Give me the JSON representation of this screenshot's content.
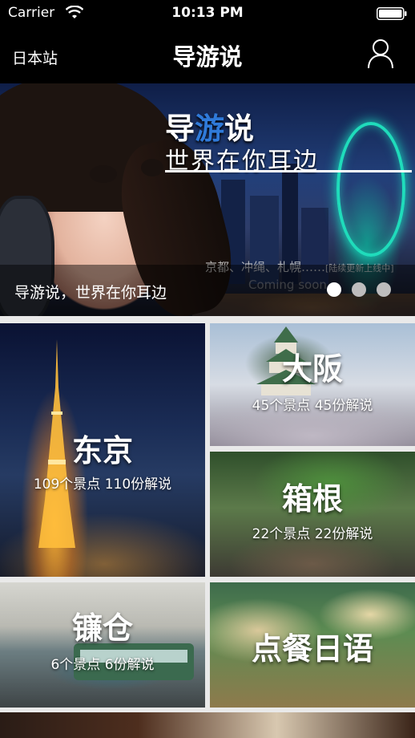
{
  "status_bar": {
    "carrier": "Carrier",
    "time": "10:13 PM"
  },
  "nav": {
    "region": "日本站",
    "title": "导游说",
    "user_icon": "user-icon"
  },
  "banner": {
    "title_part1": "导",
    "title_part2": "游",
    "title_part3": "说",
    "subtitle": "世界在你耳边",
    "note": "京都、冲绳、札幌……",
    "note_tag": "[陆续更新上线中]",
    "coming": "Coming soon",
    "caption": "导游说，世界在你耳边",
    "page_count": 3,
    "active_page": 1,
    "accent_color": "#2f7ad9"
  },
  "destinations": [
    {
      "name": "东京",
      "meta": "109个景点 110份解说"
    },
    {
      "name": "大阪",
      "meta": "45个景点 45份解说"
    },
    {
      "name": "箱根",
      "meta": "22个景点 22份解说"
    },
    {
      "name": "镰仓",
      "meta": "6个景点 6份解说"
    },
    {
      "name": "点餐日语",
      "meta": ""
    }
  ]
}
